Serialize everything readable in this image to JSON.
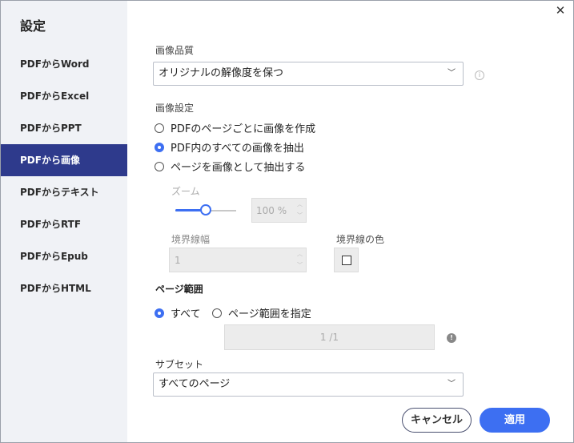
{
  "sidebar": {
    "title": "設定",
    "items": [
      {
        "label": "PDFからWord"
      },
      {
        "label": "PDFからExcel"
      },
      {
        "label": "PDFからPPT"
      },
      {
        "label": "PDFから画像"
      },
      {
        "label": "PDFからテキスト"
      },
      {
        "label": "PDFからRTF"
      },
      {
        "label": "PDFからEpub"
      },
      {
        "label": "PDFからHTML"
      }
    ],
    "active_index": 3
  },
  "quality": {
    "label": "画像品質",
    "value": "オリジナルの解像度を保つ"
  },
  "image_settings": {
    "label": "画像設定",
    "options": [
      {
        "label": "PDFのページごとに画像を作成",
        "selected": false
      },
      {
        "label": "PDF内のすべての画像を抽出",
        "selected": true
      },
      {
        "label": "ページを画像として抽出する",
        "selected": false
      }
    ]
  },
  "zoom": {
    "label": "ズーム",
    "value": "100 %",
    "slider_level": 0.5
  },
  "border_width": {
    "label": "境界線幅",
    "value": "1"
  },
  "border_color": {
    "label": "境界線の色"
  },
  "page_range": {
    "label": "ページ範囲",
    "all_label": "すべて",
    "specify_label": "ページ範囲を指定",
    "value": "1 /1"
  },
  "subset": {
    "label": "サブセット",
    "value": "すべてのページ"
  },
  "buttons": {
    "cancel": "キャンセル",
    "apply": "適用"
  },
  "colors": {
    "accent": "#3d6ff2",
    "sidebar_active": "#2e3a8c"
  }
}
